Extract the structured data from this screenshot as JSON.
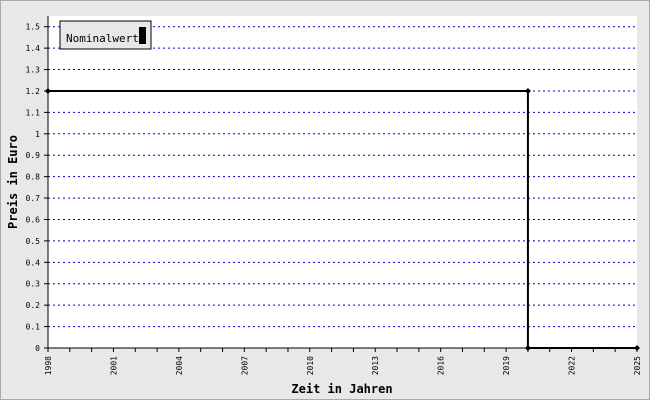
{
  "chart_data": {
    "type": "line",
    "line_shape": "step",
    "xlabel": "Zeit in Jahren",
    "ylabel": "Preis in Euro",
    "xlim": [
      1998,
      2025
    ],
    "ylim": [
      0,
      1.55
    ],
    "x_ticks": [
      "1998",
      "2001",
      "2004",
      "2007",
      "2010",
      "2013",
      "2016",
      "2019",
      "2022",
      "2025"
    ],
    "y_ticks": [
      "0",
      "0.1",
      "0.2",
      "0.3",
      "0.4",
      "0.5",
      "0.6",
      "0.7",
      "0.8",
      "0.9",
      "1",
      "1.1",
      "1.2",
      "1.3",
      "1.4",
      "1.5"
    ],
    "grid": true,
    "grid_color": "#0000cc",
    "legend_position": "top-left",
    "series": [
      {
        "name": "Nominalwert",
        "color": "#000000",
        "points": [
          {
            "x": 1998,
            "y": 1.2
          },
          {
            "x": 2020,
            "y": 1.2
          },
          {
            "x": 2020,
            "y": 0
          },
          {
            "x": 2025,
            "y": 0
          }
        ]
      }
    ]
  }
}
